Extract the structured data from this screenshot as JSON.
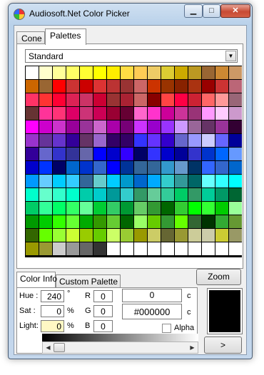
{
  "window": {
    "title": "Audiosoft.Net Color Picker"
  },
  "tabs_top": [
    {
      "label": "Cone",
      "active": false
    },
    {
      "label": "Palettes",
      "active": true
    }
  ],
  "palette_select": {
    "value": "Standard"
  },
  "palette": {
    "columns": 16,
    "colors": [
      "#ffffff",
      "#ffffcc",
      "#ffff99",
      "#ffff66",
      "#ffff33",
      "#ffff00",
      "#ffee00",
      "#ffdd44",
      "#ffcc55",
      "#eecc66",
      "#ddcc33",
      "#ccaa00",
      "#bb9922",
      "#996633",
      "#cc8833",
      "#cc9966",
      "#cc6600",
      "#996633",
      "#ff0000",
      "#cc3333",
      "#cc0000",
      "#dd3333",
      "#bb3333",
      "#993333",
      "#cc6666",
      "#cc3300",
      "#993300",
      "#882200",
      "#aa3311",
      "#990000",
      "#cc3333",
      "#bb6677",
      "#ff3366",
      "#ff3333",
      "#ff0033",
      "#dd2255",
      "#cc3366",
      "#cc0033",
      "#993333",
      "#aa2233",
      "#cc6666",
      "#880000",
      "#ff4444",
      "#ff0044",
      "#cc2233",
      "#ff6666",
      "#ff9999",
      "#996677",
      "#663333",
      "#ff3399",
      "#ff3377",
      "#dd0066",
      "#cc3377",
      "#cc0055",
      "#990033",
      "#660033",
      "#ff66cc",
      "#ff33cc",
      "#cc0099",
      "#cc3399",
      "#993377",
      "#ff99ff",
      "#ffccff",
      "#cc99cc",
      "#ff00ff",
      "#cc00cc",
      "#cc33cc",
      "#990099",
      "#993399",
      "#cc66cc",
      "#aa00aa",
      "#770077",
      "#cc33ff",
      "#9900cc",
      "#9933ff",
      "#cc99ff",
      "#996699",
      "#663366",
      "#993399",
      "#330033",
      "#9933cc",
      "#663399",
      "#6633cc",
      "#330099",
      "#663366",
      "#9966cc",
      "#330066",
      "#330066",
      "#3333ff",
      "#6633ff",
      "#3300cc",
      "#6666cc",
      "#9999ff",
      "#ccccff",
      "#6666ff",
      "#000099",
      "#330099",
      "#6666cc",
      "#3333cc",
      "#333399",
      "#6666aa",
      "#0000ff",
      "#0000cc",
      "#3300ff",
      "#000066",
      "#3333ff",
      "#0000cc",
      "#000099",
      "#3333cc",
      "#0033cc",
      "#0066ff",
      "#6699ff",
      "#0000cc",
      "#0033ff",
      "#000066",
      "#0066cc",
      "#0033cc",
      "#3366cc",
      "#0000ff",
      "#003399",
      "#336699",
      "#336699",
      "#3399cc",
      "#6699cc",
      "#003366",
      "#3366ff",
      "#3366cc",
      "#0066cc",
      "#0099ff",
      "#66ccff",
      "#00ccff",
      "#33ccff",
      "#336699",
      "#66cccc",
      "#00ccff",
      "#0099cc",
      "#0066cc",
      "#00aaff",
      "#33cccc",
      "#339999",
      "#006666",
      "#66ffff",
      "#33ffff",
      "#00ffff",
      "#00ffcc",
      "#66ffcc",
      "#33ffcc",
      "#00ffcc",
      "#00ccaa",
      "#00cccc",
      "#009999",
      "#33cccc",
      "#339966",
      "#66cc99",
      "#33cc99",
      "#00cc66",
      "#339966",
      "#00cc99",
      "#009966",
      "#006633",
      "#00cc66",
      "#33ff99",
      "#00ff66",
      "#33ff66",
      "#66ff99",
      "#00cc33",
      "#33cc66",
      "#009933",
      "#66cc66",
      "#339933",
      "#006600",
      "#33cc33",
      "#00ff00",
      "#33ff33",
      "#00cc00",
      "#99ff99",
      "#009900",
      "#00cc00",
      "#33ff00",
      "#66ff33",
      "#00aa00",
      "#339900",
      "#66cc33",
      "#006600",
      "#99ff66",
      "#66cc00",
      "#339933",
      "#66ff00",
      "#336633",
      "#003300",
      "#33aa33",
      "#669933",
      "#336600",
      "#66ff00",
      "#99ff33",
      "#ccff33",
      "#99cc00",
      "#66cc00",
      "#ccff66",
      "#99cc33",
      "#999900",
      "#cccc66",
      "#666633",
      "#999933",
      "#cccc99",
      "#ccccaa",
      "#cccc33",
      "#999966",
      "#999900",
      "#999933",
      "#cccccc",
      "#999999",
      "#666666",
      "#333333",
      "#ffffff",
      "#ffffff",
      "#ffffff",
      "#ffffff",
      "#ffffff",
      "#ffffff",
      "#ffffff",
      "#ffffff",
      "#ffffff",
      "#ffffff"
    ]
  },
  "tabs_bottom": [
    {
      "label": "Color Info",
      "active": true
    },
    {
      "label": "Custom Palette",
      "active": false
    }
  ],
  "buttons": {
    "zoom": "Zoom",
    "next": ">"
  },
  "info": {
    "hue_label": "Hue :",
    "hue_value": "240",
    "hue_unit": "°",
    "sat_label": "Sat :",
    "sat_value": "0",
    "sat_unit": "%",
    "light_label": "Light:",
    "light_value": "0",
    "light_unit": "%",
    "r_label": "R",
    "r_value": "0",
    "g_label": "G",
    "g_value": "0",
    "b_label": "B",
    "b_value": "0",
    "decimal_value": "0",
    "hex_value": "#000000",
    "copy_label": "c",
    "alpha_label": "Alpha",
    "alpha_checked": false
  },
  "preview_color": "#000000"
}
